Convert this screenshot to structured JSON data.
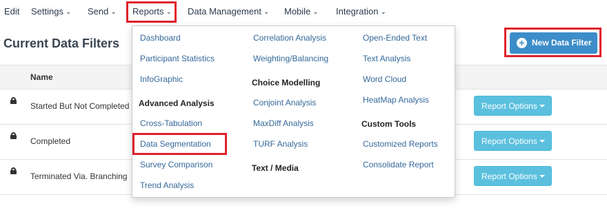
{
  "nav": {
    "edit": "Edit",
    "settings": "Settings",
    "send": "Send",
    "reports": "Reports",
    "data_management": "Data Management",
    "mobile": "Mobile",
    "integration": "Integration"
  },
  "page": {
    "title": "Current Data Filters",
    "new_filter_label": "New Data Filter"
  },
  "table": {
    "header_name": "Name",
    "rows": [
      {
        "name": "Started But Not Completed",
        "action": "Report Options"
      },
      {
        "name": "Completed",
        "action": "Report Options"
      },
      {
        "name": "Terminated Via. Branching",
        "action": "Report Options"
      }
    ]
  },
  "dropdown": {
    "col1": {
      "dashboard": "Dashboard",
      "participant_statistics": "Participant Statistics",
      "infographic": "InfoGraphic",
      "advanced_heading": "Advanced Analysis",
      "cross_tabulation": "Cross-Tabulation",
      "data_segmentation": "Data Segmentation",
      "survey_comparison": "Survey Comparison",
      "trend_analysis": "Trend Analysis"
    },
    "col2": {
      "correlation": "Correlation Analysis",
      "weighting": "Weighting/Balancing",
      "choice_heading": "Choice Modelling",
      "conjoint": "Conjoint Analysis",
      "maxdiff": "MaxDiff Analysis",
      "turf": "TURF Analysis",
      "text_media_heading": "Text / Media"
    },
    "col3": {
      "open_ended": "Open-Ended Text",
      "text_analysis": "Text Analysis",
      "word_cloud": "Word Cloud",
      "heatmap": "HeatMap Analysis",
      "custom_tools_heading": "Custom Tools",
      "customized_reports": "Customized Reports",
      "consolidate_report": "Consolidate Report"
    }
  },
  "colors": {
    "highlight": "#e0202a",
    "primary_button": "#3c8dc9",
    "info_button": "#5bc0de",
    "link": "#34689a"
  },
  "icons": {
    "dropdown_chevron": "chevron-down-icon",
    "lock": "lock-icon",
    "plus": "plus-circle-icon",
    "caret": "caret-down-icon"
  }
}
